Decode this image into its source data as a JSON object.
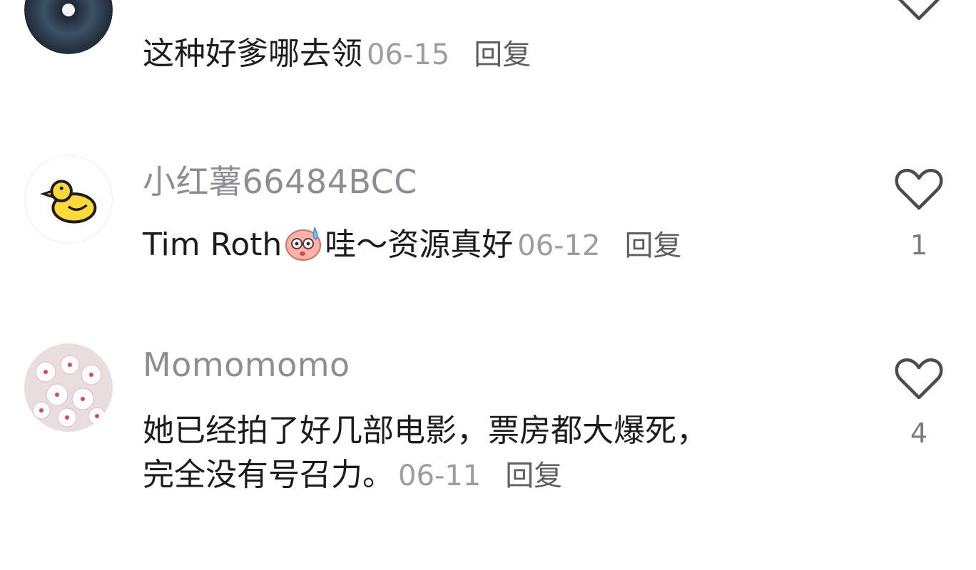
{
  "comments": [
    {
      "username": "",
      "text": "这种好爹哪去领",
      "date": "06-15",
      "reply_label": "回复",
      "like_count": "",
      "avatar_icon": "dark-blue-eye-avatar"
    },
    {
      "username": "小红薯66484BCC",
      "text_before": "Tim Roth",
      "emoji": "sweating-pink-face-emoji",
      "text_after": "哇～资源真好",
      "date": "06-12",
      "reply_label": "回复",
      "like_count": "1",
      "avatar_icon": "yellow-duck-avatar"
    },
    {
      "username": "Momomomo",
      "text_line1": "她已经拍了好几部电影，票房都大爆死，",
      "text_line2": "完全没有号召力。",
      "date": "06-11",
      "reply_label": "回复",
      "like_count": "4",
      "avatar_icon": "cherry-blossom-avatar"
    }
  ],
  "colors": {
    "username": "#8d8d93",
    "text": "#1c1c1e",
    "date": "#9c9ca2",
    "heart_outline": "#4a4a50"
  }
}
